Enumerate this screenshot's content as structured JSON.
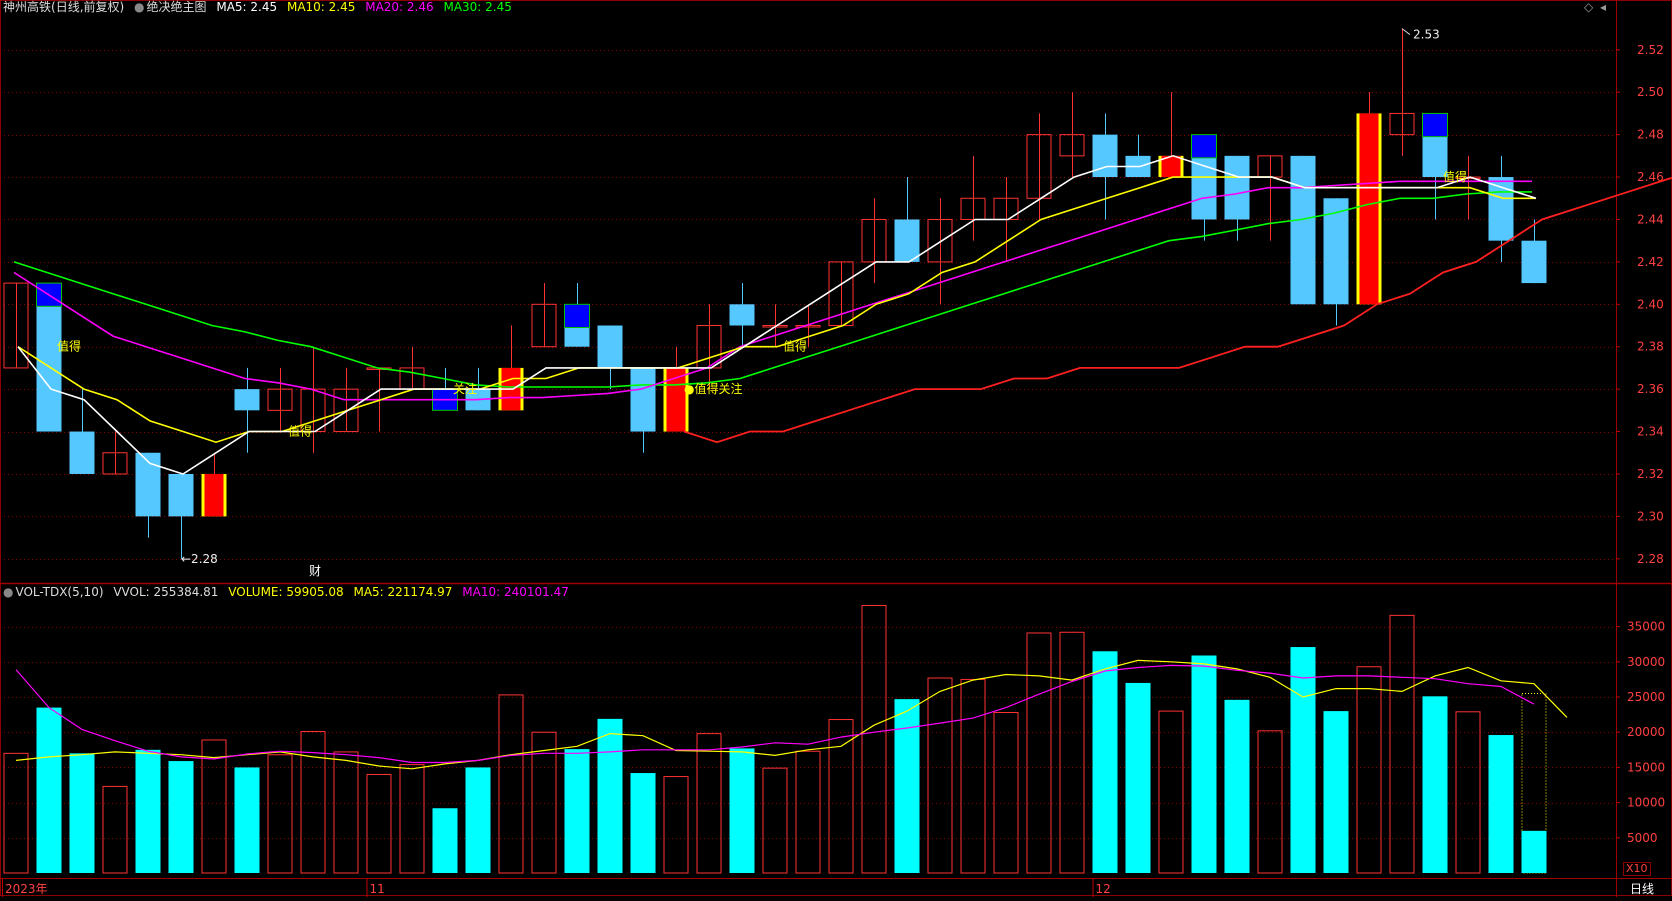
{
  "header": {
    "stock": "神州高铁",
    "period_tag": "(日线,前复权)",
    "formula": "绝决绝主图",
    "ma5": "MA5: 2.45",
    "ma10": "MA10: 2.45",
    "ma20": "MA20: 2.46",
    "ma30": "MA30: 2.45"
  },
  "vol_header": {
    "title": "VOL-TDX(5,10)",
    "vvol": "VVOL: 255384.81",
    "volume": "VOLUME: 59905.08",
    "ma5": "MA5: 221174.97",
    "ma10": "MA10: 240101.47"
  },
  "colors": {
    "up": "#ff3232",
    "down": "#54c8ff",
    "vol_down": "#00ffff",
    "ma5": "#ffffff",
    "ma10": "#ffff00",
    "ma20": "#ff00ff",
    "ma30": "#00ff00",
    "grid": "#8b0000",
    "blue_box": "#0000ff",
    "yellow_label": "#ffff00"
  },
  "price_axis": {
    "ticks": [
      "2.52",
      "2.50",
      "2.48",
      "2.46",
      "2.44",
      "2.42",
      "2.40",
      "2.38",
      "2.36",
      "2.34",
      "2.32",
      "2.30",
      "2.28"
    ]
  },
  "volume_axis": {
    "ticks": [
      "35000",
      "30000",
      "25000",
      "20000",
      "15000",
      "10000",
      "5000"
    ],
    "unit": "X10"
  },
  "date_axis": {
    "labels": [
      {
        "text": "2023年",
        "index": 0
      },
      {
        "text": "11",
        "index": 11
      },
      {
        "text": "12",
        "index": 33
      }
    ],
    "period": "日线"
  },
  "markers": {
    "high": "2.53",
    "low": "2.28",
    "finance": "财"
  },
  "signals": [
    {
      "text": "值得",
      "index": 1,
      "price": 2.38
    },
    {
      "text": "值得",
      "index": 8,
      "price": 2.34
    },
    {
      "text": "关注",
      "index": 13,
      "price": 2.36
    },
    {
      "text": "●值得关注",
      "index": 20,
      "price": 2.36
    },
    {
      "text": "值得",
      "index": 23,
      "price": 2.38
    },
    {
      "text": "值得",
      "index": 43,
      "price": 2.46
    }
  ],
  "chart_data": {
    "type": "candlestick",
    "price_range": [
      2.27,
      2.535
    ],
    "volume_range": [
      0,
      38500
    ],
    "candles": [
      {
        "o": 2.37,
        "c": 2.41,
        "h": 2.41,
        "l": 2.37,
        "v": 17000,
        "s": "up"
      },
      {
        "o": 2.41,
        "c": 2.34,
        "h": 2.41,
        "l": 2.34,
        "v": 23500,
        "s": "down",
        "box": "blue"
      },
      {
        "o": 2.34,
        "c": 2.32,
        "h": 2.36,
        "l": 2.32,
        "v": 17000,
        "s": "down"
      },
      {
        "o": 2.33,
        "c": 2.32,
        "h": 2.34,
        "l": 2.32,
        "v": 12300,
        "s": "up"
      },
      {
        "o": 2.33,
        "c": 2.3,
        "h": 2.33,
        "l": 2.29,
        "v": 17500,
        "s": "down"
      },
      {
        "o": 2.32,
        "c": 2.3,
        "h": 2.32,
        "l": 2.28,
        "v": 15900,
        "s": "down"
      },
      {
        "o": 2.3,
        "c": 2.32,
        "h": 2.33,
        "l": 2.3,
        "v": 18900,
        "s": "up",
        "box": "red"
      },
      {
        "o": 2.35,
        "c": 2.36,
        "h": 2.37,
        "l": 2.33,
        "v": 15000,
        "s": "down"
      },
      {
        "o": 2.35,
        "c": 2.36,
        "h": 2.37,
        "l": 2.34,
        "v": 16800,
        "s": "up"
      },
      {
        "o": 2.34,
        "c": 2.36,
        "h": 2.38,
        "l": 2.33,
        "v": 20100,
        "s": "up"
      },
      {
        "o": 2.34,
        "c": 2.36,
        "h": 2.37,
        "l": 2.34,
        "v": 17200,
        "s": "up"
      },
      {
        "o": 2.37,
        "c": 2.37,
        "h": 2.37,
        "l": 2.34,
        "v": 14000,
        "s": "up"
      },
      {
        "o": 2.36,
        "c": 2.37,
        "h": 2.38,
        "l": 2.36,
        "v": 15400,
        "s": "up"
      },
      {
        "o": 2.36,
        "c": 2.35,
        "h": 2.37,
        "l": 2.35,
        "v": 9200,
        "s": "down",
        "box": "blue"
      },
      {
        "o": 2.36,
        "c": 2.35,
        "h": 2.37,
        "l": 2.35,
        "v": 15000,
        "s": "down"
      },
      {
        "o": 2.35,
        "c": 2.37,
        "h": 2.39,
        "l": 2.35,
        "v": 25300,
        "s": "up",
        "box": "red"
      },
      {
        "o": 2.38,
        "c": 2.4,
        "h": 2.41,
        "l": 2.38,
        "v": 20000,
        "s": "up"
      },
      {
        "o": 2.4,
        "c": 2.38,
        "h": 2.41,
        "l": 2.38,
        "v": 17600,
        "s": "down",
        "box": "blue"
      },
      {
        "o": 2.39,
        "c": 2.37,
        "h": 2.39,
        "l": 2.36,
        "v": 21900,
        "s": "down"
      },
      {
        "o": 2.37,
        "c": 2.34,
        "h": 2.37,
        "l": 2.33,
        "v": 14200,
        "s": "down"
      },
      {
        "o": 2.34,
        "c": 2.37,
        "h": 2.38,
        "l": 2.34,
        "v": 13700,
        "s": "up",
        "box": "red"
      },
      {
        "o": 2.37,
        "c": 2.39,
        "h": 2.4,
        "l": 2.36,
        "v": 19800,
        "s": "up"
      },
      {
        "o": 2.4,
        "c": 2.39,
        "h": 2.41,
        "l": 2.38,
        "v": 17700,
        "s": "down"
      },
      {
        "o": 2.39,
        "c": 2.39,
        "h": 2.4,
        "l": 2.38,
        "v": 14900,
        "s": "up"
      },
      {
        "o": 2.39,
        "c": 2.39,
        "h": 2.4,
        "l": 2.38,
        "v": 17300,
        "s": "up"
      },
      {
        "o": 2.39,
        "c": 2.42,
        "h": 2.42,
        "l": 2.39,
        "v": 21800,
        "s": "up"
      },
      {
        "o": 2.42,
        "c": 2.44,
        "h": 2.45,
        "l": 2.41,
        "v": 38000,
        "s": "up"
      },
      {
        "o": 2.44,
        "c": 2.42,
        "h": 2.46,
        "l": 2.42,
        "v": 24700,
        "s": "down"
      },
      {
        "o": 2.42,
        "c": 2.44,
        "h": 2.45,
        "l": 2.4,
        "v": 27700,
        "s": "up"
      },
      {
        "o": 2.44,
        "c": 2.45,
        "h": 2.47,
        "l": 2.43,
        "v": 27500,
        "s": "up"
      },
      {
        "o": 2.44,
        "c": 2.45,
        "h": 2.46,
        "l": 2.42,
        "v": 22800,
        "s": "up"
      },
      {
        "o": 2.45,
        "c": 2.48,
        "h": 2.49,
        "l": 2.44,
        "v": 34100,
        "s": "up"
      },
      {
        "o": 2.47,
        "c": 2.48,
        "h": 2.5,
        "l": 2.46,
        "v": 34200,
        "s": "up"
      },
      {
        "o": 2.48,
        "c": 2.46,
        "h": 2.49,
        "l": 2.44,
        "v": 31500,
        "s": "down"
      },
      {
        "o": 2.46,
        "c": 2.47,
        "h": 2.48,
        "l": 2.46,
        "v": 27000,
        "s": "down"
      },
      {
        "o": 2.46,
        "c": 2.47,
        "h": 2.5,
        "l": 2.46,
        "v": 23000,
        "s": "up",
        "box": "red"
      },
      {
        "o": 2.48,
        "c": 2.44,
        "h": 2.48,
        "l": 2.43,
        "v": 30900,
        "s": "down",
        "box": "blue"
      },
      {
        "o": 2.47,
        "c": 2.44,
        "h": 2.47,
        "l": 2.43,
        "v": 24600,
        "s": "down"
      },
      {
        "o": 2.46,
        "c": 2.47,
        "h": 2.47,
        "l": 2.43,
        "v": 20200,
        "s": "up"
      },
      {
        "o": 2.47,
        "c": 2.4,
        "h": 2.47,
        "l": 2.4,
        "v": 32100,
        "s": "down"
      },
      {
        "o": 2.45,
        "c": 2.4,
        "h": 2.45,
        "l": 2.39,
        "v": 23000,
        "s": "down"
      },
      {
        "o": 2.4,
        "c": 2.49,
        "h": 2.5,
        "l": 2.4,
        "v": 29300,
        "s": "up",
        "box": "red"
      },
      {
        "o": 2.48,
        "c": 2.49,
        "h": 2.53,
        "l": 2.47,
        "v": 36600,
        "s": "up"
      },
      {
        "o": 2.49,
        "c": 2.46,
        "h": 2.49,
        "l": 2.44,
        "v": 25100,
        "s": "down",
        "box": "blue"
      },
      {
        "o": 2.46,
        "c": 2.46,
        "h": 2.47,
        "l": 2.44,
        "v": 22900,
        "s": "up"
      },
      {
        "o": 2.46,
        "c": 2.43,
        "h": 2.47,
        "l": 2.42,
        "v": 19600,
        "s": "down"
      },
      {
        "o": 2.43,
        "c": 2.41,
        "h": 2.44,
        "l": 2.41,
        "v": 5990,
        "s": "down",
        "vol_box": 25500
      }
    ],
    "ma5": [
      2.38,
      2.36,
      2.355,
      2.34,
      2.325,
      2.32,
      2.33,
      2.34,
      2.34,
      2.34,
      2.35,
      2.36,
      2.36,
      2.36,
      2.36,
      2.36,
      2.37,
      2.37,
      2.37,
      2.37,
      2.37,
      2.37,
      2.38,
      2.39,
      2.4,
      2.41,
      2.42,
      2.42,
      2.43,
      2.44,
      2.44,
      2.45,
      2.46,
      2.465,
      2.465,
      2.47,
      2.465,
      2.46,
      2.46,
      2.455,
      2.455,
      2.455,
      2.455,
      2.455,
      2.46,
      2.455,
      2.45
    ],
    "ma10": [
      2.38,
      2.37,
      2.36,
      2.355,
      2.345,
      2.34,
      2.335,
      2.34,
      2.34,
      2.345,
      2.35,
      2.355,
      2.36,
      2.36,
      2.36,
      2.365,
      2.365,
      2.37,
      2.37,
      2.37,
      2.37,
      2.375,
      2.38,
      2.38,
      2.385,
      2.39,
      2.4,
      2.405,
      2.415,
      2.42,
      2.43,
      2.44,
      2.445,
      2.45,
      2.455,
      2.46,
      2.46,
      2.46,
      2.46,
      2.455,
      2.455,
      2.455,
      2.455,
      2.455,
      2.455,
      2.45,
      2.45
    ],
    "ma20": [
      2.415,
      2.405,
      2.395,
      2.385,
      2.38,
      2.375,
      2.37,
      2.365,
      2.363,
      2.36,
      2.355,
      2.355,
      2.355,
      2.355,
      2.355,
      2.356,
      2.356,
      2.357,
      2.358,
      2.36,
      2.365,
      2.37,
      2.38,
      2.385,
      2.39,
      2.395,
      2.4,
      2.405,
      2.41,
      2.415,
      2.42,
      2.425,
      2.43,
      2.435,
      2.44,
      2.445,
      2.45,
      2.452,
      2.455,
      2.455,
      2.456,
      2.457,
      2.458,
      2.458,
      2.458,
      2.458,
      2.458
    ],
    "ma30": [
      2.42,
      2.415,
      2.41,
      2.405,
      2.4,
      2.395,
      2.39,
      2.387,
      2.383,
      2.38,
      2.375,
      2.37,
      2.368,
      2.365,
      2.362,
      2.361,
      2.361,
      2.361,
      2.361,
      2.362,
      2.362,
      2.363,
      2.365,
      2.37,
      2.375,
      2.38,
      2.385,
      2.39,
      2.395,
      2.4,
      2.405,
      2.41,
      2.415,
      2.42,
      2.425,
      2.43,
      2.432,
      2.435,
      2.438,
      2.44,
      2.443,
      2.447,
      2.45,
      2.45,
      2.452,
      2.453,
      2.453
    ],
    "vol_ma5": [
      16000,
      16500,
      16800,
      17200,
      17000,
      16800,
      16400,
      16800,
      17200,
      16500,
      16000,
      15200,
      14800,
      15500,
      16000,
      16800,
      17400,
      18000,
      19800,
      19500,
      17400,
      17300,
      17200,
      16700,
      17500,
      18000,
      21000,
      23000,
      25800,
      27400,
      28200,
      28000,
      27400,
      29000,
      30200,
      30000,
      29700,
      29000,
      27800,
      25000,
      26200,
      26200,
      25800,
      28000,
      29200,
      27300,
      26900,
      22100
    ],
    "vol_ma10": [
      28900,
      23500,
      20400,
      18800,
      17300,
      16500,
      16200,
      16900,
      17300,
      17100,
      16800,
      16400,
      15700,
      15700,
      16000,
      16700,
      17000,
      17000,
      17200,
      17500,
      17500,
      17500,
      17900,
      18500,
      18300,
      19300,
      20000,
      20600,
      21300,
      22000,
      23500,
      25400,
      27200,
      28700,
      29200,
      29500,
      29400,
      28800,
      28400,
      27700,
      28000,
      28000,
      27800,
      27600,
      26900,
      26500,
      24000
    ]
  }
}
